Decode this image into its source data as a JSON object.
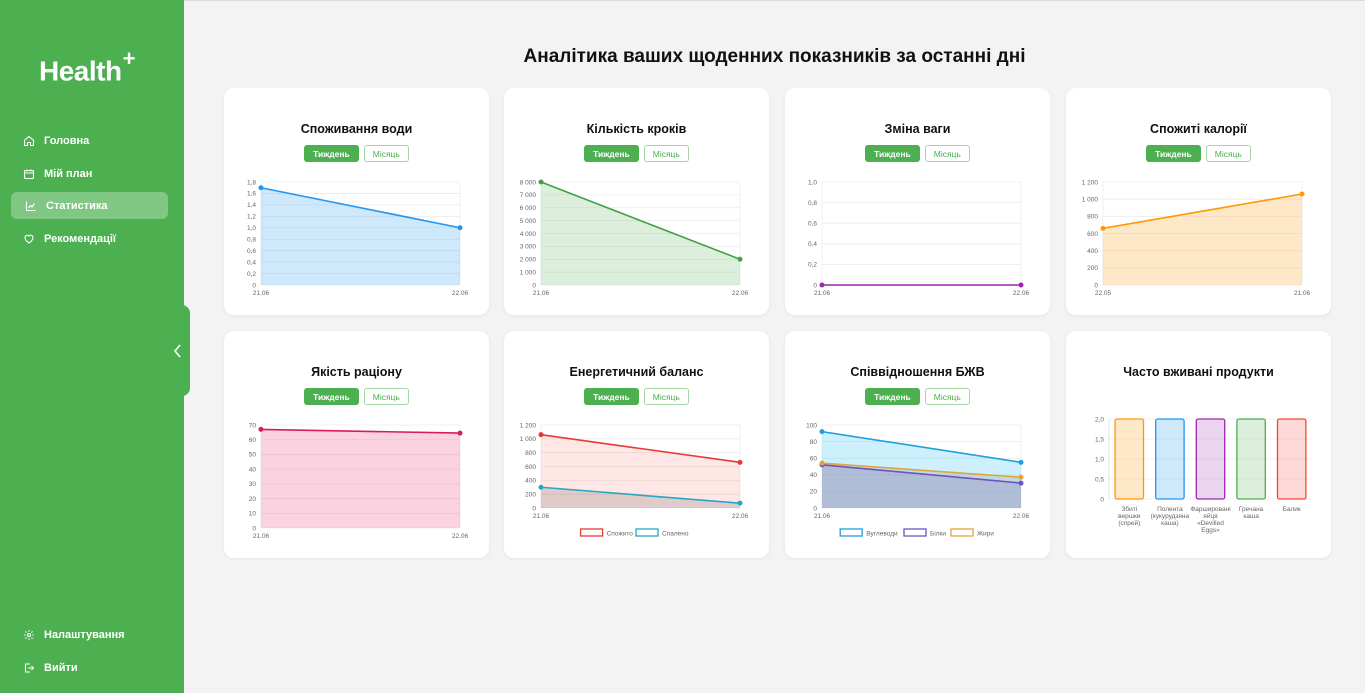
{
  "app": {
    "logo": "Health",
    "logo_mark": "+"
  },
  "sidebar": {
    "items": [
      {
        "label": "Головна",
        "icon": "home-icon"
      },
      {
        "label": "Мій план",
        "icon": "calendar-icon"
      },
      {
        "label": "Статистика",
        "icon": "chart-icon"
      },
      {
        "label": "Рекомендації",
        "icon": "heart-icon"
      }
    ],
    "bottom": [
      {
        "label": "Налаштування",
        "icon": "gear-icon"
      },
      {
        "label": "Вийти",
        "icon": "logout-icon"
      }
    ]
  },
  "page": {
    "title": "Аналітика ваших щоденних показників за останні дні"
  },
  "toggle": {
    "week": "Тиждень",
    "month": "Місяць"
  },
  "colors": {
    "accent": "#4caf50"
  },
  "cards": [
    {
      "title": "Споживання води",
      "toggle": true
    },
    {
      "title": "Кількість кроків",
      "toggle": true
    },
    {
      "title": "Зміна ваги",
      "toggle": true
    },
    {
      "title": "Спожиті калорії",
      "toggle": true
    },
    {
      "title": "Якість раціону",
      "toggle": true
    },
    {
      "title": "Енергетичний баланс",
      "toggle": true
    },
    {
      "title": "Співвідношення БЖВ",
      "toggle": true
    },
    {
      "title": "Часто вживані продукти",
      "toggle": false
    }
  ],
  "chart_data": [
    {
      "type": "area",
      "x": [
        "21.06",
        "22.06"
      ],
      "series": [
        {
          "values": [
            1.7,
            1.0
          ],
          "color": "#2196f3",
          "fill": "rgba(33,150,243,0.22)"
        }
      ],
      "ylim": [
        0,
        1.8
      ],
      "yticks": [
        "0",
        "0,2",
        "0,4",
        "0,6",
        "0,8",
        "1,0",
        "1,2",
        "1,4",
        "1,6",
        "1,8"
      ]
    },
    {
      "type": "area",
      "x": [
        "21.06",
        "22.06"
      ],
      "series": [
        {
          "values": [
            8000,
            2000
          ],
          "color": "#43a047",
          "fill": "rgba(76,175,80,0.2)"
        }
      ],
      "ylim": [
        0,
        8000
      ],
      "yticks": [
        "0",
        "1 000",
        "2 000",
        "3 000",
        "4 000",
        "5 000",
        "6 000",
        "7 000",
        "8 000"
      ]
    },
    {
      "type": "line",
      "x": [
        "21.06",
        "22.06"
      ],
      "series": [
        {
          "values": [
            0,
            0
          ],
          "color": "#9c27b0",
          "fill": "none"
        }
      ],
      "ylim": [
        0,
        1
      ],
      "yticks": [
        "0",
        "0,2",
        "0,4",
        "0,6",
        "0,8",
        "1,0"
      ]
    },
    {
      "type": "area",
      "x": [
        "22.05",
        "21.06"
      ],
      "series": [
        {
          "values": [
            660,
            1060
          ],
          "color": "#ff9800",
          "fill": "rgba(255,152,0,0.22)"
        }
      ],
      "ylim": [
        0,
        1200
      ],
      "yticks": [
        "0",
        "200",
        "400",
        "600",
        "800",
        "1 000",
        "1 200"
      ]
    },
    {
      "type": "area",
      "x": [
        "21.06",
        "22.06"
      ],
      "series": [
        {
          "values": [
            67,
            64.5
          ],
          "color": "#d81b60",
          "fill": "rgba(233,30,99,0.2)"
        }
      ],
      "ylim": [
        0,
        70
      ],
      "yticks": [
        "0",
        "10",
        "20",
        "30",
        "40",
        "50",
        "60",
        "70"
      ]
    },
    {
      "type": "area",
      "x": [
        "21.06",
        "22.06"
      ],
      "series": [
        {
          "name": "Спожито",
          "values": [
            1060,
            660
          ],
          "color": "#e53935",
          "fill": "rgba(244,67,54,0.13)"
        },
        {
          "name": "Спалено",
          "values": [
            300,
            70
          ],
          "color": "#26a7c6",
          "fill": "rgba(0,0,0,0.12)"
        }
      ],
      "ylim": [
        0,
        1200
      ],
      "yticks": [
        "0",
        "200",
        "400",
        "600",
        "800",
        "1 000",
        "1 200"
      ],
      "legend": "bottom"
    },
    {
      "type": "area",
      "x": [
        "21.06",
        "22.06"
      ],
      "series": [
        {
          "name": "Вуглеводи",
          "values": [
            92,
            55
          ],
          "color": "#1e9fdf",
          "fill": "rgba(33,180,243,0.22)"
        },
        {
          "name": "Білки",
          "values": [
            52,
            30
          ],
          "color": "#6e53c2",
          "fill": "rgba(103,58,183,0.18)"
        },
        {
          "name": "Жири",
          "values": [
            54,
            37
          ],
          "color": "#e0a537",
          "fill": "rgba(120,120,100,0.18)"
        }
      ],
      "ylim": [
        0,
        100
      ],
      "yticks": [
        "0",
        "20",
        "40",
        "60",
        "80",
        "100"
      ],
      "legend": "bottom"
    },
    {
      "type": "bar",
      "categories": [
        "Збиті вершки (спрей)",
        "Полента (кукурудзяна каша)",
        "Фаршировані яйця «Devilled Eggs»",
        "Гречана каша",
        "Балик"
      ],
      "values": [
        2,
        2,
        2,
        2,
        2
      ],
      "colors": [
        "#ff9800",
        "#2196f3",
        "#9c27b0",
        "#4caf50",
        "#f44336"
      ],
      "fills": [
        "rgba(255,152,0,0.22)",
        "rgba(33,150,243,0.22)",
        "rgba(156,39,176,0.2)",
        "rgba(76,175,80,0.2)",
        "rgba(244,67,54,0.2)"
      ],
      "ylim": [
        0,
        2.0
      ],
      "yticks": [
        "0",
        "0,5",
        "1,0",
        "1,5",
        "2,0"
      ]
    }
  ]
}
